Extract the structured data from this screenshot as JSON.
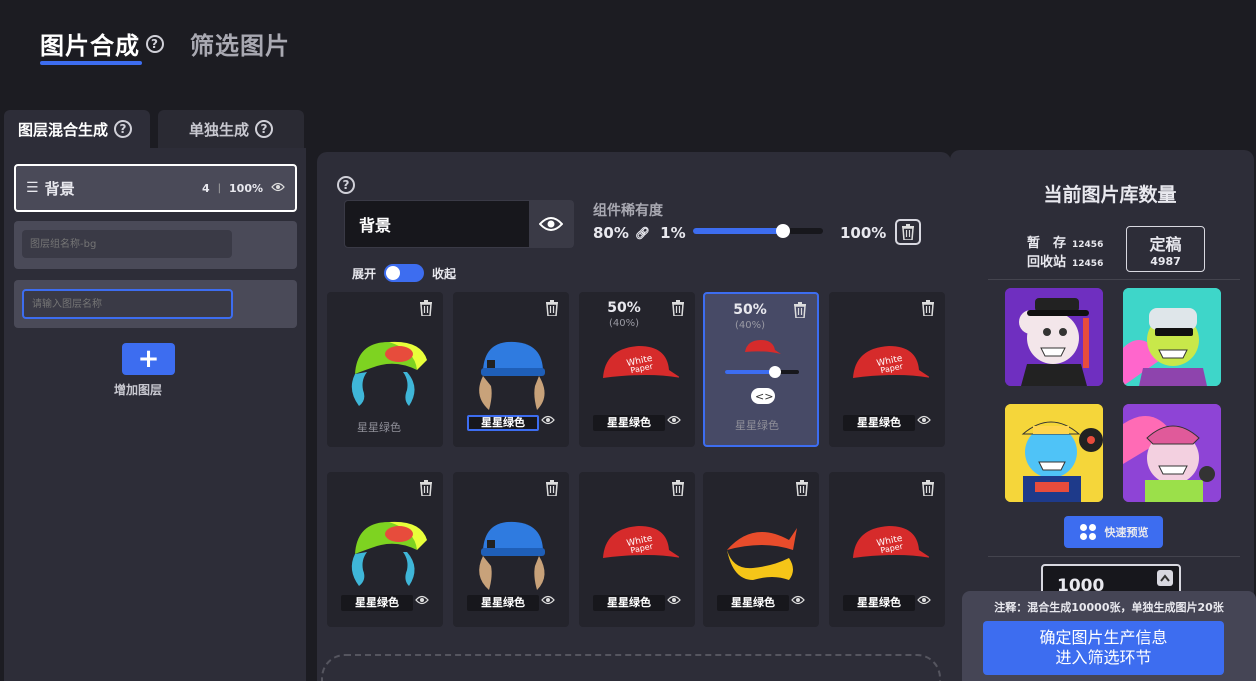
{
  "top_tabs": [
    {
      "label": "图片合成"
    },
    {
      "label": "筛选图片"
    }
  ],
  "sub_tabs": [
    {
      "label": "图层混合生成"
    },
    {
      "label": "单独生成"
    }
  ],
  "left": {
    "layer_name": "背景",
    "layer_count": "4",
    "layer_percent": "100%",
    "group_placeholder": "图层组名称-bg",
    "layer_input_placeholder": "请输入图层名称",
    "add_label": "增加图层"
  },
  "center": {
    "layer_title": "背景",
    "rarity_label": "组件稀有度",
    "rarity_current": "80%",
    "rarity_min": "1%",
    "rarity_max": "100%",
    "rarity_slider_value": 0.7,
    "expand_label": "展开",
    "collapse_label": "收起",
    "cells": [
      {
        "label": "星星绿色",
        "style": "plain",
        "pct": "",
        "sub": "",
        "hat": "green"
      },
      {
        "label": "星星绿色",
        "style": "outlined",
        "pct": "",
        "sub": "",
        "hat": "blue"
      },
      {
        "label": "星星绿色",
        "style": "box",
        "pct": "50%",
        "sub": "(40%)",
        "hat": "red"
      },
      {
        "label": "星星绿色",
        "style": "plain",
        "pct": "50%",
        "sub": "(40%)",
        "hat": "red-small",
        "selected": true
      },
      {
        "label": "星星绿色",
        "style": "box",
        "pct": "",
        "sub": "",
        "hat": "red"
      },
      {
        "label": "星星绿色",
        "style": "box",
        "pct": "",
        "sub": "",
        "hat": "green"
      },
      {
        "label": "星星绿色",
        "style": "box",
        "pct": "",
        "sub": "",
        "hat": "blue"
      },
      {
        "label": "星星绿色",
        "style": "box",
        "pct": "",
        "sub": "",
        "hat": "red"
      },
      {
        "label": "星星绿色",
        "style": "box",
        "pct": "",
        "sub": "",
        "hat": "crown"
      },
      {
        "label": "星星绿色",
        "style": "box",
        "pct": "",
        "sub": "",
        "hat": "red"
      }
    ]
  },
  "right": {
    "title": "当前图片库数量",
    "stock_label": "暂　存",
    "stock_value": "12456",
    "recycle_label": "回收站",
    "recycle_value": "12456",
    "final_label": "定稿",
    "final_value": "4987",
    "preview_label": "快速预览",
    "quantity": "1000",
    "note": "注释：混合生成10000张，单独生成图片20张",
    "confirm_line1": "确定图片生产信息",
    "confirm_line2": "进入筛选环节"
  },
  "colors": {
    "accent": "#3d6df0",
    "background": "#1c1c22",
    "panel": "#2d2d38"
  }
}
